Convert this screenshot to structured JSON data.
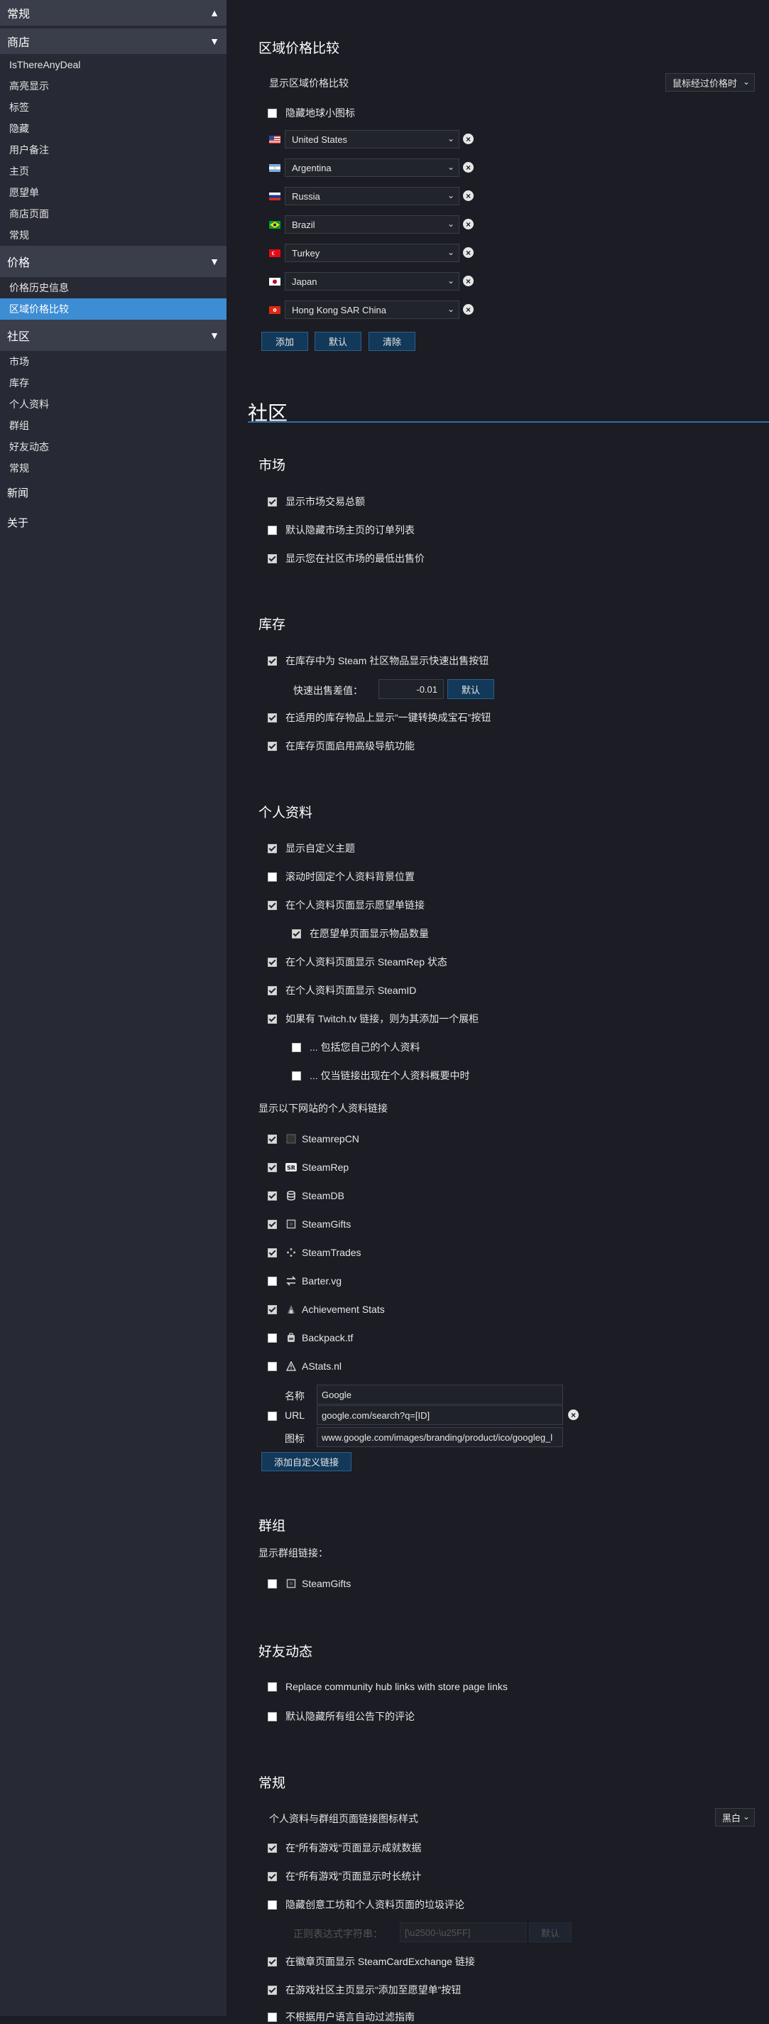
{
  "sidebar": {
    "general_top": "常规",
    "store": {
      "header": "商店",
      "items": [
        "IsThereAnyDeal",
        "高亮显示",
        "标签",
        "隐藏",
        "用户备注",
        "主页",
        "愿望单",
        "商店页面",
        "常规"
      ]
    },
    "price": {
      "header": "价格",
      "items": [
        "价格历史信息",
        "区域价格比较"
      ]
    },
    "community": {
      "header": "社区",
      "items": [
        "市场",
        "库存",
        "个人资料",
        "群组",
        "好友动态",
        "常规"
      ]
    },
    "news": "新闻",
    "about": "关于"
  },
  "regional": {
    "title": "区域价格比较",
    "show_label": "显示区域价格比较",
    "show_select": "鼠标经过价格时",
    "hide_globe": "隐藏地球小图标",
    "countries": [
      {
        "name": "United States",
        "flag": "us-flag"
      },
      {
        "name": "Argentina",
        "flag": "ar-flag"
      },
      {
        "name": "Russia",
        "flag": "ru-flag"
      },
      {
        "name": "Brazil",
        "flag": "br-flag"
      },
      {
        "name": "Turkey",
        "flag": "tr-flag"
      },
      {
        "name": "Japan",
        "flag": "jp-flag"
      },
      {
        "name": "Hong Kong SAR China",
        "flag": "hk-flag"
      }
    ],
    "btn_add": "添加",
    "btn_default": "默认",
    "btn_clear": "清除"
  },
  "community_title": "社区",
  "market": {
    "title": "市场",
    "opts": [
      {
        "label": "显示市场交易总额",
        "checked": true
      },
      {
        "label": "默认隐藏市场主页的订单列表",
        "checked": false
      },
      {
        "label": "显示您在社区市场的最低出售价",
        "checked": true
      }
    ]
  },
  "inventory": {
    "title": "库存",
    "quick_sell": "在库存中为 Steam 社区物品显示快速出售按钮",
    "diff_label": "快速出售差值：",
    "diff_value": "-0.01",
    "diff_default": "默认",
    "gem_btn": "在适用的库存物品上显示“一键转换成宝石”按钮",
    "nav": "在库存页面启用高级导航功能"
  },
  "profile": {
    "title": "个人资料",
    "custom_theme": "显示自定义主题",
    "fix_bg": "滚动时固定个人资料背景位置",
    "wishlist_link": "在个人资料页面显示愿望单链接",
    "wishlist_count": "在愿望单页面显示物品数量",
    "steamrep": "在个人资料页面显示 SteamRep 状态",
    "steamid": "在个人资料页面显示 SteamID",
    "twitch": "如果有 Twitch.tv 链接，则为其添加一个展柜",
    "twitch_own": "... 包括您自己的个人资料",
    "twitch_summary": "... 仅当链接出现在个人资料概要中时",
    "sites_label": "显示以下网站的个人资料链接",
    "sites": [
      {
        "name": "SteamrepCN",
        "checked": true,
        "icon": "steamrepcn-icon"
      },
      {
        "name": "SteamRep",
        "checked": true,
        "icon": "steamrep-icon"
      },
      {
        "name": "SteamDB",
        "checked": true,
        "icon": "steamdb-icon"
      },
      {
        "name": "SteamGifts",
        "checked": true,
        "icon": "steamgifts-icon"
      },
      {
        "name": "SteamTrades",
        "checked": true,
        "icon": "steamtrades-icon"
      },
      {
        "name": "Barter.vg",
        "checked": false,
        "icon": "bartervg-icon"
      },
      {
        "name": "Achievement Stats",
        "checked": true,
        "icon": "achievementstats-icon"
      },
      {
        "name": "Backpack.tf",
        "checked": false,
        "icon": "backpacktf-icon"
      },
      {
        "name": "AStats.nl",
        "checked": false,
        "icon": "astats-icon"
      }
    ],
    "custom": {
      "name_label": "名称",
      "name_value": "Google",
      "url_label": "URL",
      "url_value": "google.com/search?q=[ID]",
      "icon_label": "图标",
      "icon_value": "www.google.com/images/branding/product/ico/googleg_l"
    },
    "add_custom": "添加自定义链接"
  },
  "groups": {
    "title": "群组",
    "label": "显示群组链接：",
    "site": "SteamGifts"
  },
  "friends": {
    "title": "好友动态",
    "opt1": "Replace community hub links with store page links",
    "opt2": "默认隐藏所有组公告下的评论"
  },
  "general": {
    "title": "常规",
    "icon_style_label": "个人资料与群组页面链接图标样式",
    "icon_style_value": "黑白",
    "opts": [
      {
        "label": "在“所有游戏”页面显示成就数据",
        "checked": true
      },
      {
        "label": "在“所有游戏”页面显示时长统计",
        "checked": true
      },
      {
        "label": "隐藏创意工坊和个人资料页面的垃圾评论",
        "checked": false
      }
    ],
    "regex_label": "正则表达式字符串：",
    "regex_value": "[\\u2500-\\u25FF]",
    "regex_default": "默认",
    "badge_link": "在徽章页面显示 SteamCardExchange 链接",
    "wishlist_btn": "在游戏社区主页显示“添加至愿望单”按钮",
    "last_partial": "不根据用户语言自动过滤指南"
  }
}
